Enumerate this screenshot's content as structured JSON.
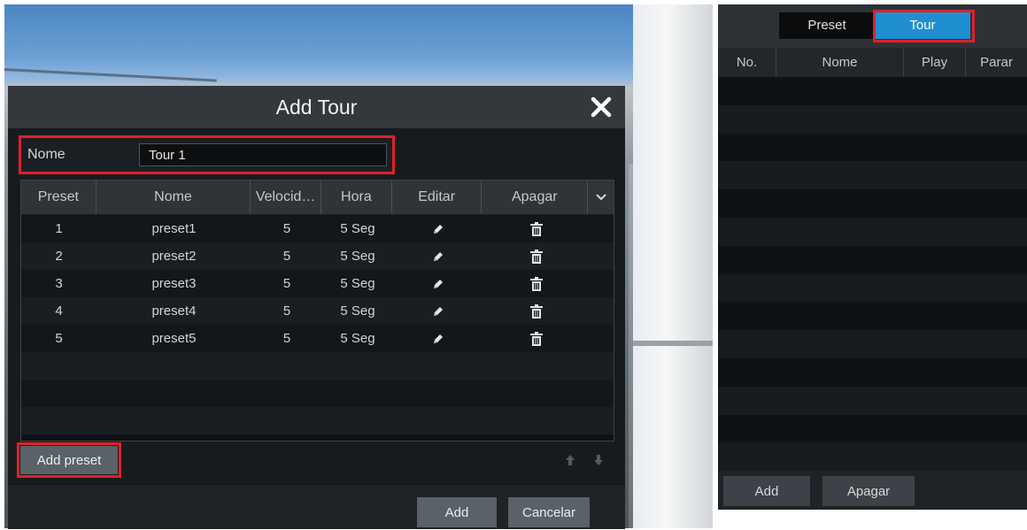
{
  "dialog": {
    "title": "Add Tour",
    "name_label": "Nome",
    "name_value": "Tour 1",
    "table": {
      "headers": [
        "Preset",
        "Nome",
        "Velocid…",
        "Hora",
        "Editar",
        "Apagar"
      ],
      "rows": [
        {
          "preset": "1",
          "name": "preset1",
          "speed": "5",
          "time": "5 Seg"
        },
        {
          "preset": "2",
          "name": "preset2",
          "speed": "5",
          "time": "5 Seg"
        },
        {
          "preset": "3",
          "name": "preset3",
          "speed": "5",
          "time": "5 Seg"
        },
        {
          "preset": "4",
          "name": "preset4",
          "speed": "5",
          "time": "5 Seg"
        },
        {
          "preset": "5",
          "name": "preset5",
          "speed": "5",
          "time": "5 Seg"
        }
      ]
    },
    "add_preset_label": "Add preset",
    "add_label": "Add",
    "cancel_label": "Cancelar"
  },
  "tour_panel": {
    "tabs": [
      "Preset",
      "Tour"
    ],
    "active_tab": "Tour",
    "headers": [
      "No.",
      "Nome",
      "Play",
      "Parar"
    ],
    "add_label": "Add",
    "delete_label": "Apagar"
  },
  "colors": {
    "highlight": "#e0202c",
    "active_tab": "#1f8fd2"
  },
  "icons": [
    "close-icon",
    "edit-icon",
    "trash-icon",
    "chevron-down-icon",
    "arrow-up-icon",
    "arrow-down-icon"
  ]
}
